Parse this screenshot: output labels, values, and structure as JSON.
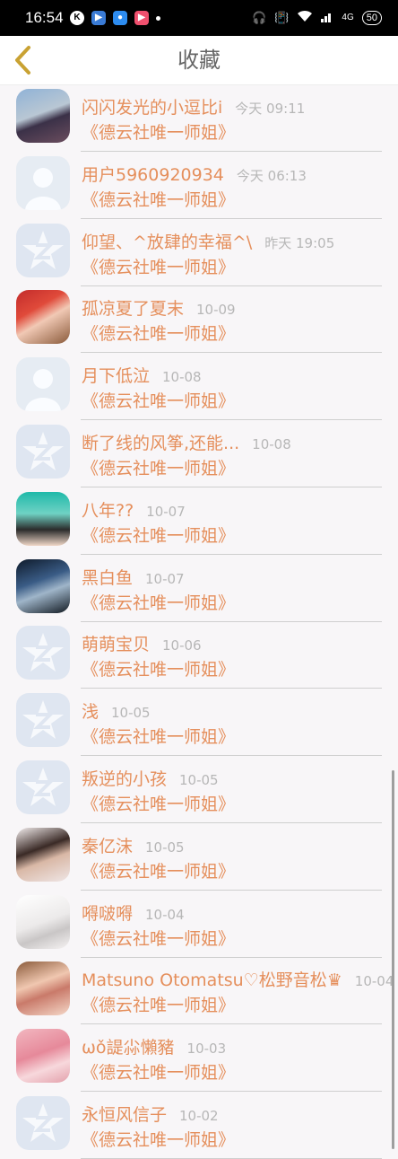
{
  "status_bar": {
    "time": "16:54",
    "left_icons": [
      "k-icon",
      "app-icon-1",
      "app-icon-2",
      "app-icon-3",
      "dot"
    ],
    "network": "4G",
    "battery": "50"
  },
  "header": {
    "title": "收藏",
    "back_icon": "chevron-left-icon"
  },
  "colors": {
    "accent": "#e58f5c",
    "muted": "#b7b7b7",
    "back": "#c9a233"
  },
  "items": [
    {
      "nickname": "闪闪发光的小逗比i",
      "time": "今天 09:11",
      "subtitle": "《德云社唯一师姐》",
      "avatar": "photo"
    },
    {
      "nickname": "用户5960920934",
      "time": "今天 06:13",
      "subtitle": "《德云社唯一师姐》",
      "avatar": "placeholder"
    },
    {
      "nickname": "仰望、^放肆的幸福^\\",
      "time": "昨天 19:05",
      "subtitle": "《德云社唯一师姐》",
      "avatar": "default"
    },
    {
      "nickname": "孤凉夏了夏末",
      "time": "10-09",
      "subtitle": "《德云社唯一师姐》",
      "avatar": "photo"
    },
    {
      "nickname": "月下低泣",
      "time": "10-08",
      "subtitle": "《德云社唯一师姐》",
      "avatar": "placeholder"
    },
    {
      "nickname": "断了线的风筝,还能...",
      "time": "10-08",
      "subtitle": "《德云社唯一师姐》",
      "avatar": "default"
    },
    {
      "nickname": "八年??",
      "time": "10-07",
      "subtitle": "《德云社唯一师姐》",
      "avatar": "photo"
    },
    {
      "nickname": "黑白鱼",
      "time": "10-07",
      "subtitle": "《德云社唯一师姐》",
      "avatar": "photo"
    },
    {
      "nickname": "萌萌宝贝",
      "time": "10-06",
      "subtitle": "《德云社唯一师姐》",
      "avatar": "default"
    },
    {
      "nickname": "浅",
      "time": "10-05",
      "subtitle": "《德云社唯一师姐》",
      "avatar": "default"
    },
    {
      "nickname": "叛逆的小孩",
      "time": "10-05",
      "subtitle": "《德云社唯一师姐》",
      "avatar": "default"
    },
    {
      "nickname": "秦亿沫",
      "time": "10-05",
      "subtitle": "《德云社唯一师姐》",
      "avatar": "photo"
    },
    {
      "nickname": "嘚啵嘚",
      "time": "10-04",
      "subtitle": "《德云社唯一师姐》",
      "avatar": "photo"
    },
    {
      "nickname": "Matsuno Otomatsu♡松野音松♛",
      "time": "10-04",
      "subtitle": "《德云社唯一师姐》",
      "avatar": "photo"
    },
    {
      "nickname": "ωǒ諟尛懶豬",
      "time": "10-03",
      "subtitle": "《德云社唯一师姐》",
      "avatar": "photo"
    },
    {
      "nickname": "永恒风信子",
      "time": "10-02",
      "subtitle": "《德云社唯一师姐》",
      "avatar": "default"
    }
  ]
}
